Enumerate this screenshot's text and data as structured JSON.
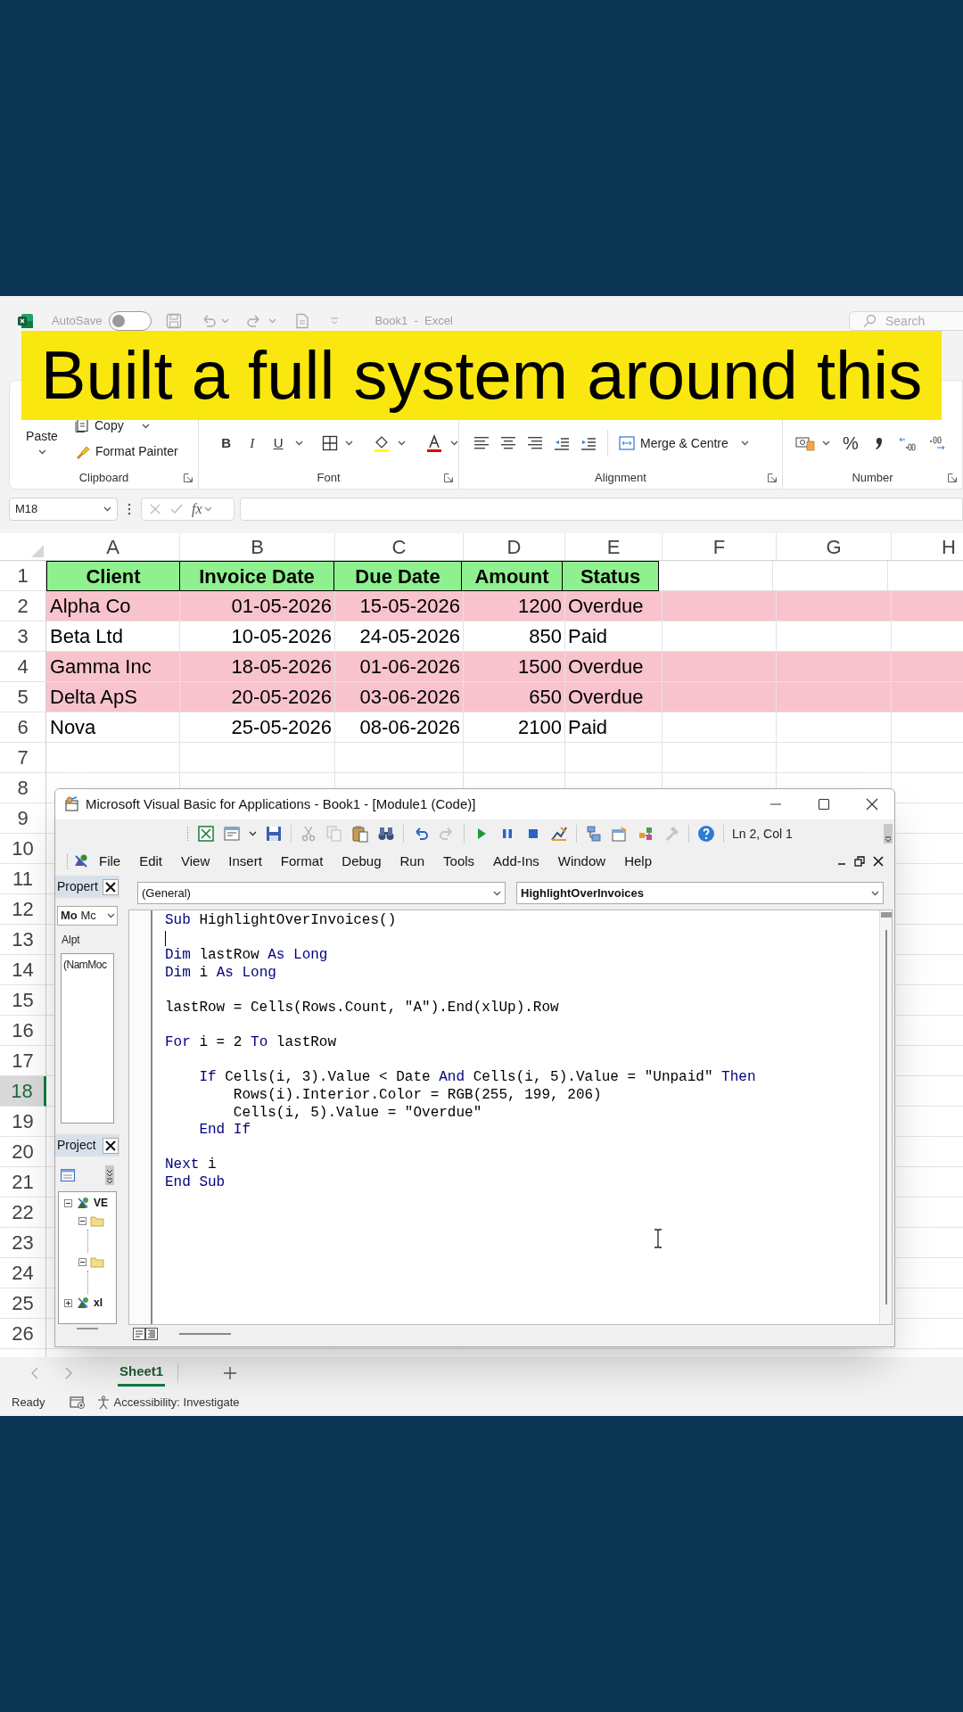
{
  "excel": {
    "title_bar": {
      "autosave_label": "AutoSave",
      "autosave_on": false,
      "title": "Book1  -  Excel",
      "search_placeholder": "Search"
    },
    "ribbon": {
      "paste": "Paste",
      "copy": "Copy",
      "format_painter": "Format Painter",
      "font_buttons": [
        "B",
        "I",
        "U"
      ],
      "merge": "Merge & Centre",
      "percent": "%",
      "groups": [
        "Clipboard",
        "Font",
        "Alignment",
        "Number"
      ]
    },
    "formula_bar": {
      "name_box": "M18",
      "fx": "fx"
    },
    "columns": [
      "A",
      "B",
      "C",
      "D",
      "E",
      "F",
      "G",
      "H"
    ],
    "row_headers": [
      {
        "label": "1",
        "selected": false
      },
      {
        "label": "2",
        "selected": false
      },
      {
        "label": "3",
        "selected": false
      },
      {
        "label": "4",
        "selected": false
      },
      {
        "label": "5",
        "selected": false
      },
      {
        "label": "6",
        "selected": false
      },
      {
        "label": "7",
        "selected": false
      },
      {
        "label": "8",
        "selected": false
      },
      {
        "label": "9",
        "selected": false
      },
      {
        "label": "10",
        "selected": false
      },
      {
        "label": "11",
        "selected": false
      },
      {
        "label": "12",
        "selected": false
      },
      {
        "label": "13",
        "selected": false
      },
      {
        "label": "14",
        "selected": false
      },
      {
        "label": "15",
        "selected": false
      },
      {
        "label": "16",
        "selected": false
      },
      {
        "label": "17",
        "selected": false
      },
      {
        "label": "18",
        "selected": true
      },
      {
        "label": "19",
        "selected": false
      },
      {
        "label": "20",
        "selected": false
      },
      {
        "label": "21",
        "selected": false
      },
      {
        "label": "22",
        "selected": false
      },
      {
        "label": "23",
        "selected": false
      },
      {
        "label": "24",
        "selected": false
      },
      {
        "label": "25",
        "selected": false
      },
      {
        "label": "26",
        "selected": false
      }
    ],
    "table": {
      "header": [
        "Client",
        "Invoice Date",
        "Due Date",
        "Amount",
        "Status"
      ],
      "rows": [
        {
          "cells": [
            "Alpha Co",
            "01-05-2026",
            "15-05-2026",
            "1200",
            "Overdue"
          ],
          "highlighted": true
        },
        {
          "cells": [
            "Beta Ltd",
            "10-05-2026",
            "24-05-2026",
            "850",
            "Paid"
          ],
          "highlighted": false
        },
        {
          "cells": [
            "Gamma Inc",
            "18-05-2026",
            "01-06-2026",
            "1500",
            "Overdue"
          ],
          "highlighted": true
        },
        {
          "cells": [
            "Delta ApS",
            "20-05-2026",
            "03-06-2026",
            "650",
            "Overdue"
          ],
          "highlighted": true
        },
        {
          "cells": [
            "Nova",
            "25-05-2026",
            "08-06-2026",
            "2100",
            "Paid"
          ],
          "highlighted": false
        }
      ]
    },
    "sheet_tabs": [
      {
        "label": "Sheet1",
        "selected": true
      }
    ],
    "status_bar": {
      "ready": "Ready",
      "accessibility": "Accessibility: Investigate"
    }
  },
  "banner": "Built a full system around this",
  "vba": {
    "title": "Microsoft Visual Basic for Applications - Book1 - [Module1 (Code)]",
    "position": "Ln 2, Col 1",
    "menu": [
      "File",
      "Edit",
      "View",
      "Insert",
      "Format",
      "Debug",
      "Run",
      "Tools",
      "Add-Ins",
      "Window",
      "Help"
    ],
    "properties": {
      "title": "Propert",
      "object": "**Mo** Mc",
      "tab": "Alpt",
      "grid_header": [
        "(Nam",
        "Moc"
      ]
    },
    "project": {
      "title": "Project",
      "tree": [
        {
          "label": "VE",
          "expanded": true,
          "children": [
            {
              "kind": "folder",
              "expanded": true
            },
            {
              "kind": "folder",
              "expanded": true
            }
          ]
        },
        {
          "label": "xl",
          "expanded": false
        }
      ]
    },
    "object_dropdown": "(General)",
    "procedure_dropdown": "HighlightOverInvoices",
    "code_blocks": [
      [
        [
          {
            "text": "Sub",
            "kind": "keyword"
          },
          {
            "text": " HighlightOverInvoices()",
            "kind": "plain"
          }
        ]
      ],
      [
        [
          {
            "text": "Dim",
            "kind": "keyword"
          },
          {
            "text": " lastRow ",
            "kind": "plain"
          },
          {
            "text": "As Long",
            "kind": "keyword"
          }
        ],
        [
          {
            "text": "Dim",
            "kind": "keyword"
          },
          {
            "text": " i ",
            "kind": "plain"
          },
          {
            "text": "As Long",
            "kind": "keyword"
          }
        ]
      ],
      [
        [
          {
            "text": "lastRow = Cells(Rows.Count, \"A\").End(xlUp).Row",
            "kind": "plain"
          }
        ]
      ],
      [
        [
          {
            "text": "For",
            "kind": "keyword"
          },
          {
            "text": " i = 2 ",
            "kind": "plain"
          },
          {
            "text": "To",
            "kind": "keyword"
          },
          {
            "text": " lastRow",
            "kind": "plain"
          }
        ]
      ],
      [
        [
          {
            "text": "    If",
            "kind": "keyword"
          },
          {
            "text": " Cells(i, 3).Value < Date ",
            "kind": "plain"
          },
          {
            "text": "And",
            "kind": "keyword"
          },
          {
            "text": " Cells(i, 5).Value = \"Unpaid\" ",
            "kind": "plain"
          },
          {
            "text": "Then",
            "kind": "keyword"
          }
        ],
        [
          {
            "text": "        Rows(i).Interior.Color = RGB(255, 199, 206)",
            "kind": "plain"
          }
        ],
        [
          {
            "text": "        Cells(i, 5).Value = \"Overdue\"",
            "kind": "plain"
          }
        ],
        [
          {
            "text": "    End If",
            "kind": "keyword"
          }
        ]
      ],
      [
        [
          {
            "text": "Next",
            "kind": "keyword"
          },
          {
            "text": " i",
            "kind": "plain"
          }
        ],
        [
          {
            "text": "End Sub",
            "kind": "keyword"
          }
        ]
      ]
    ]
  }
}
